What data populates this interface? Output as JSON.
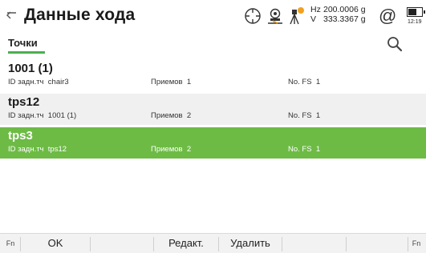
{
  "header": {
    "title": "Данные хода",
    "hz_label": "Hz",
    "hz_value": "200.0006 g",
    "v_label": "V",
    "v_value": "333.3367 g",
    "at_symbol": "@",
    "clock": "12:19",
    "icons": [
      "back-arrow-icon",
      "target-icon",
      "instrument-icon",
      "tripod-warning-icon",
      "battery-icon"
    ]
  },
  "tabs": {
    "active": "Точки"
  },
  "rows": [
    {
      "name": "1001 (1)",
      "id_label": "ID задн.тч",
      "id_value": "chair3",
      "sets_label": "Приемов",
      "sets_value": "1",
      "fs_label": "No. FS",
      "fs_value": "1",
      "selected": false
    },
    {
      "name": "tps12",
      "id_label": "ID задн.тч",
      "id_value": "1001 (1)",
      "sets_label": "Приемов",
      "sets_value": "2",
      "fs_label": "No. FS",
      "fs_value": "1",
      "selected": false
    },
    {
      "name": "tps3",
      "id_label": "ID задн.тч",
      "id_value": "tps12",
      "sets_label": "Приемов",
      "sets_value": "2",
      "fs_label": "No. FS",
      "fs_value": "1",
      "selected": true
    }
  ],
  "footer": {
    "fn_left": "Fn",
    "ok": "OK",
    "edit": "Редакт.",
    "delete": "Удалить",
    "fn_right": "Fn"
  },
  "colors": {
    "accent": "#6dbb45",
    "underline": "#4caf50"
  }
}
